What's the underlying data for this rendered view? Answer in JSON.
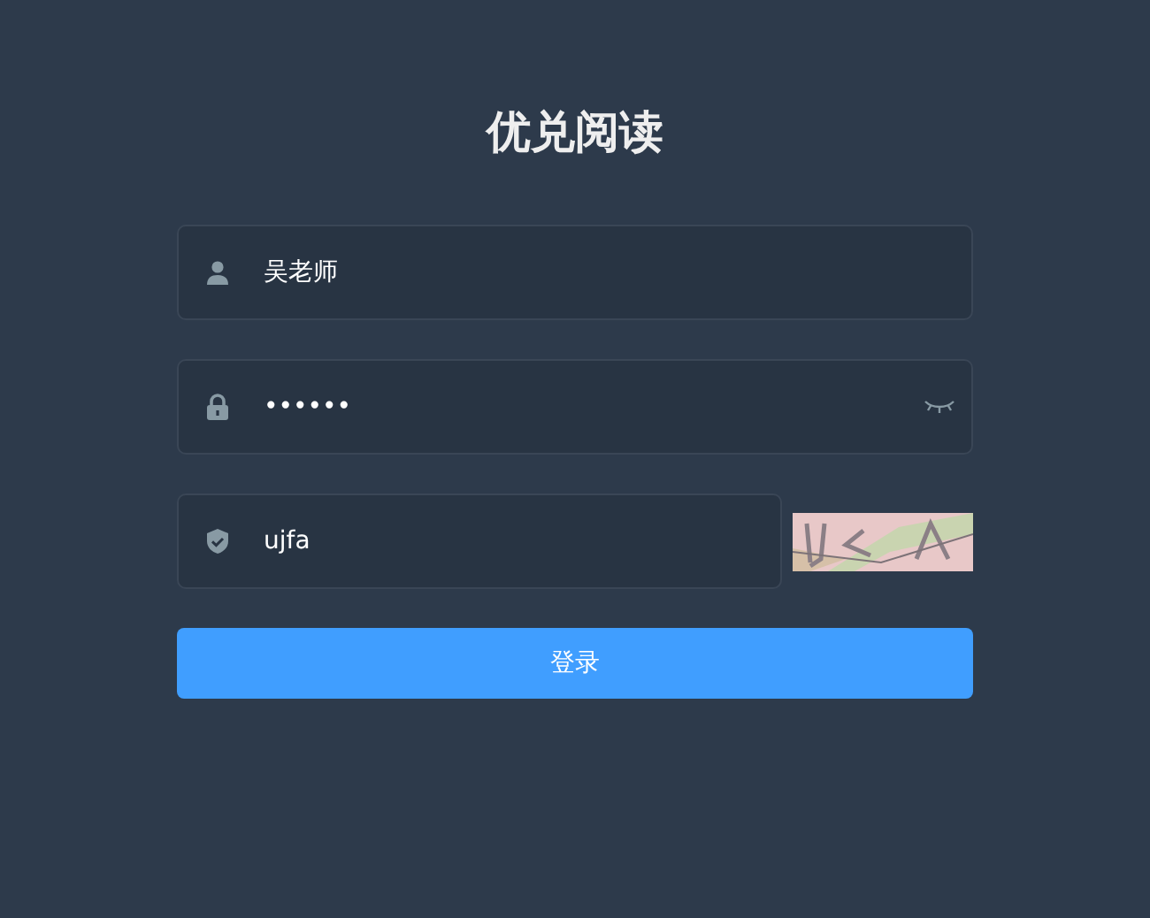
{
  "title": "优兑阅读",
  "fields": [
    {
      "kind": "user",
      "value": "吴老师"
    },
    {
      "kind": "password",
      "value": "••••••"
    },
    {
      "kind": "captcha",
      "value": "ujfa"
    }
  ],
  "login_button": "登录"
}
